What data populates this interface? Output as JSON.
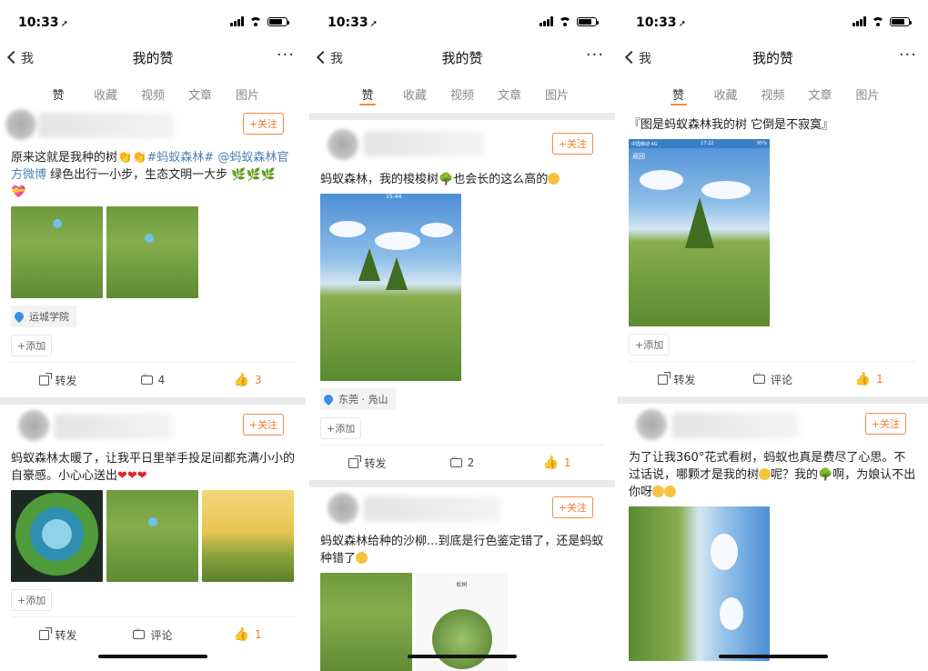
{
  "status": {
    "time": "10:33",
    "loc_arrow": "➚"
  },
  "nav": {
    "back": "我",
    "title": "我的赞",
    "more": "···"
  },
  "tabs": [
    "赞",
    "收藏",
    "视频",
    "文章",
    "图片"
  ],
  "follow_label": "+关注",
  "add_label": "+添加",
  "share_label": "转发",
  "comment_label": "评论",
  "phone1": {
    "post1": {
      "text_a": "原来这就是我种的树",
      "tag1": "#蚂蚁森林#",
      "tag2": "@蚂蚁森林官方微博",
      "text_b": "绿色出行一小步，生态文明一大步",
      "location": "运城学院",
      "comments": "4",
      "likes": "3"
    },
    "post2": {
      "text": "蚂蚁森林太暖了，让我平日里举手投足间都充满小小的自豪感。小心心送出",
      "likes": "1"
    }
  },
  "phone2": {
    "post1": {
      "text": "蚂蚁森林，我的梭梭树",
      "text_b": "也会长的这么高的",
      "location": "东莞 · 凫山",
      "comments": "2",
      "likes": "1",
      "screen_time": "15:44"
    },
    "post2": {
      "text": "蚂蚁森林给种的沙柳...到底是行色鉴定错了，还是蚂蚁种错了",
      "img_title": "松树"
    }
  },
  "phone3": {
    "post1": {
      "text": "『图是蚂蚁森林我的树 它倒是不寂寞』",
      "screen_carrier": "中国移动  4G",
      "screen_time": "17:22",
      "screen_back": "返回",
      "screen_battery": "95%",
      "likes": "1"
    },
    "post2": {
      "text_a": "为了让我360°花式看树，蚂蚁也真是费尽了心思。不过话说，哪颗才是我的树",
      "text_b": "呢？我的",
      "text_c": "啊，为娘认不出你呀"
    }
  }
}
